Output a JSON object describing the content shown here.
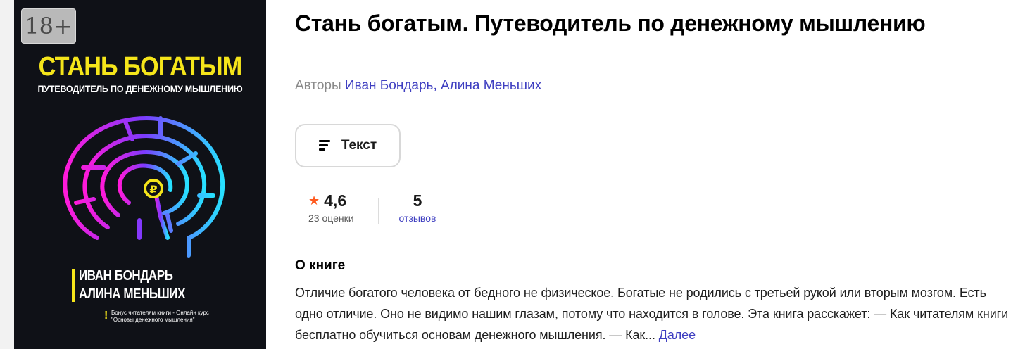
{
  "cover": {
    "age_rating": "18+",
    "title": "СТАНЬ БОГАТЫМ",
    "subtitle": "ПУТЕВОДИТЕЛЬ ПО ДЕНЕЖНОМУ МЫШЛЕНИЮ",
    "authors": [
      "ИВАН БОНДАРЬ",
      "АЛИНА МЕНЬШИХ"
    ],
    "bonus_mark": "!",
    "bonus_lines": [
      "Бонус читателям книги - Онлайн курс",
      "\"Основы денежного мышления\""
    ],
    "colors": {
      "background": "#0f1117",
      "accent": "#f5e51a"
    }
  },
  "book": {
    "title": "Стань богатым. Путеводитель по денежному мышлению",
    "authors_label": "Авторы",
    "authors": [
      "Иван Бондарь",
      "Алина Меньших"
    ],
    "author_separator": ", "
  },
  "format": {
    "label": "Текст",
    "icon": "text-lines-icon"
  },
  "stats": {
    "rating_icon": "star-icon",
    "rating": "4,6",
    "rating_count": "23 оценки",
    "reviews_count": "5",
    "reviews_label": "отзывов"
  },
  "about": {
    "heading": "О книге",
    "text": "Отличие богатого человека от бедного не физическое. Богатые не родились с третьей рукой или вторым мозгом. Есть одно отличие. Оно не видимо нашим глазам, потому что находится в голове. Эта книга расскажет: — Как читателям книги бесплатно обучиться основам денежного мышления. — Как...",
    "more_label": "Далее"
  },
  "colors": {
    "link": "#3f3fc1",
    "star": "#ff5a1f"
  }
}
